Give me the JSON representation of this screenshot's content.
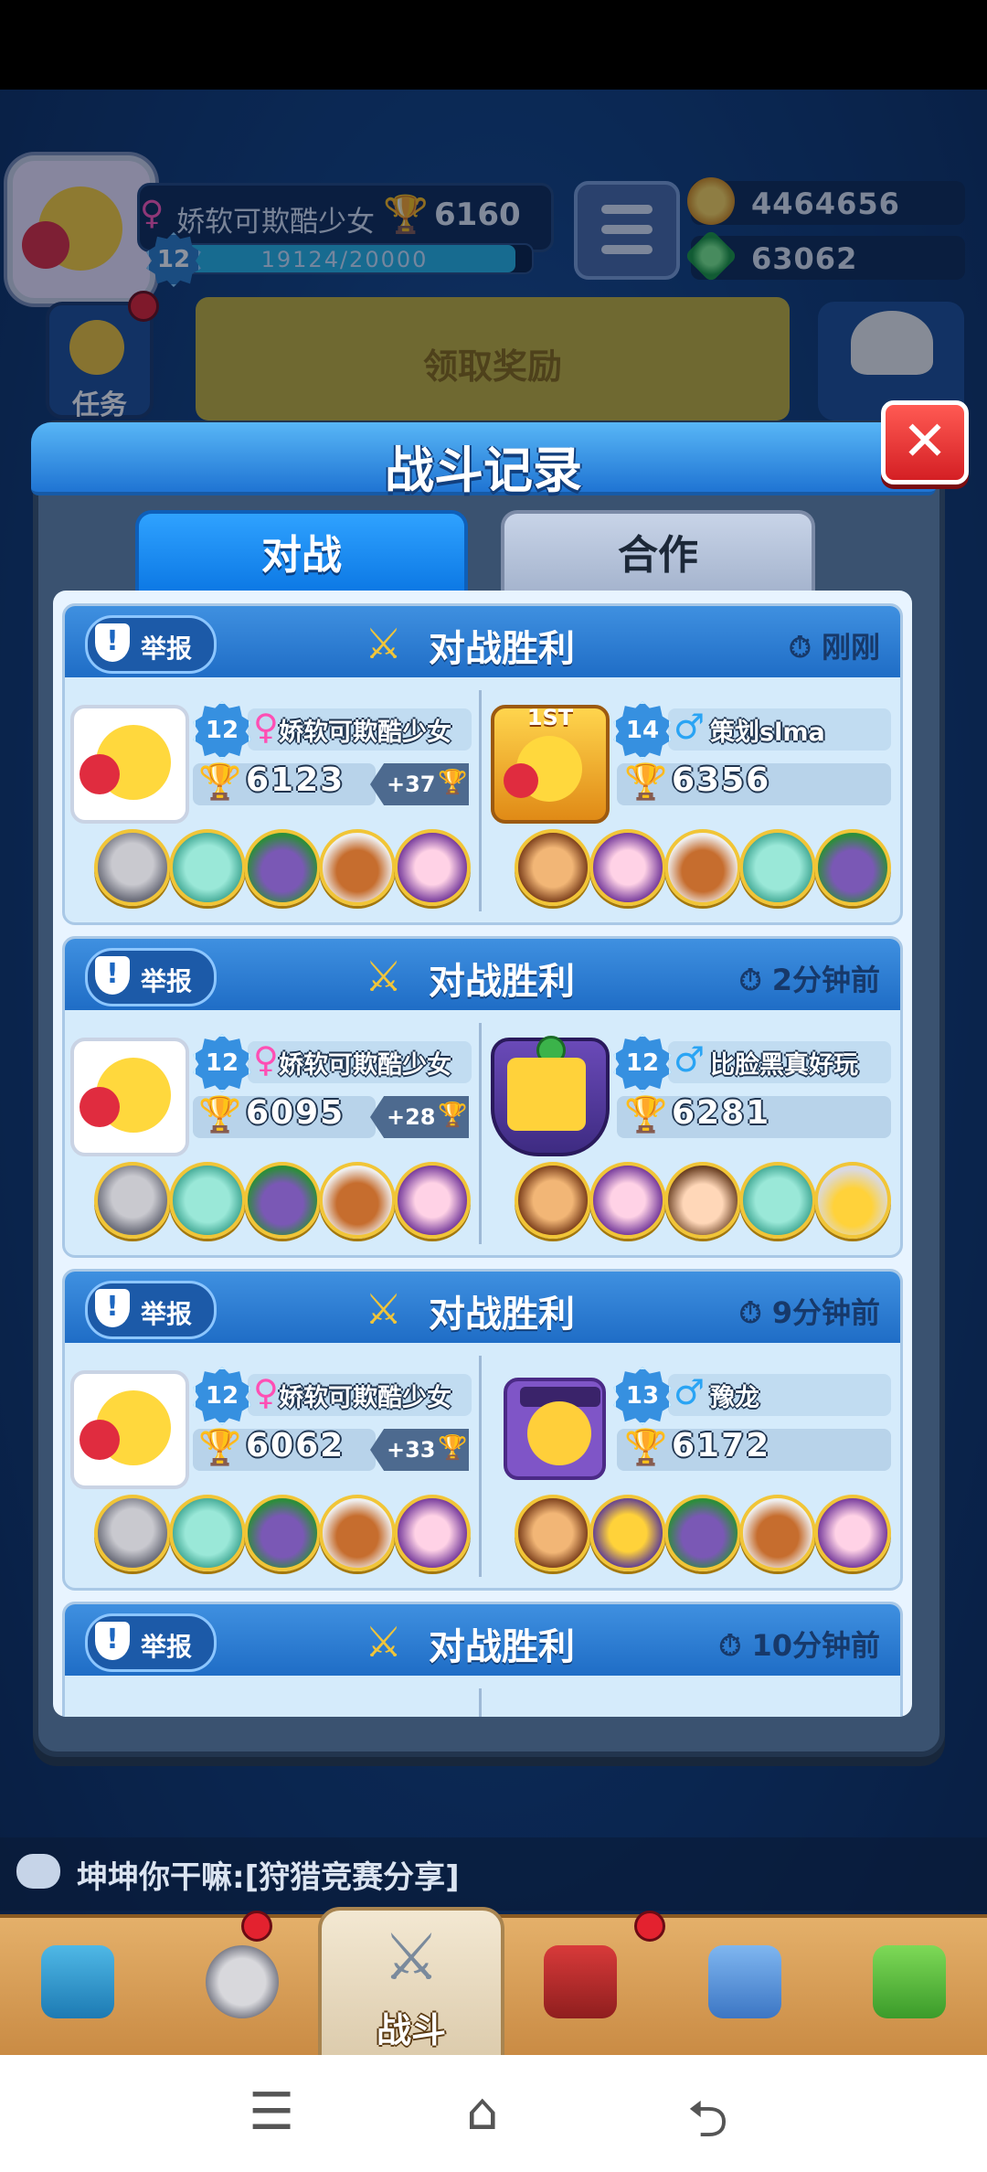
{
  "hud": {
    "player_name": "娇软可欺酷少女",
    "trophies": "6160",
    "level": "12",
    "xp_text": "19124/20000",
    "xp_fraction": 0.956,
    "coins": "4464656",
    "gems": "63062",
    "task_label": "任务",
    "reward_label": "领取奖励"
  },
  "dialog": {
    "title": "战斗记录",
    "close_label": "✕",
    "tabs": [
      {
        "label": "对战",
        "active": true
      },
      {
        "label": "合作",
        "active": false
      }
    ],
    "report_label": "举报",
    "records": [
      {
        "result": "对战胜利",
        "time": "刚刚",
        "left": {
          "level": "12",
          "gender": "♀",
          "name": "娇软可欺酷少女",
          "trophies": "6123",
          "delta": "+37",
          "heroes": [
            "knight",
            "cat",
            "green",
            "dwarf",
            "purple"
          ]
        },
        "right": {
          "level": "14",
          "gender": "♂",
          "name": "策划slma",
          "trophies": "6356",
          "badge": "1ST",
          "heroes": [
            "monkey",
            "purple",
            "dwarf",
            "cat",
            "green"
          ]
        }
      },
      {
        "result": "对战胜利",
        "time": "2分钟前",
        "left": {
          "level": "12",
          "gender": "♀",
          "name": "娇软可欺酷少女",
          "trophies": "6095",
          "delta": "+28",
          "heroes": [
            "knight",
            "cat",
            "green",
            "dwarf",
            "purple"
          ]
        },
        "right": {
          "level": "12",
          "gender": "♂",
          "name": "比脸黑真好玩",
          "trophies": "6281",
          "heroes": [
            "monkey",
            "purple",
            "girl",
            "cat",
            "ghost"
          ]
        }
      },
      {
        "result": "对战胜利",
        "time": "9分钟前",
        "left": {
          "level": "12",
          "gender": "♀",
          "name": "娇软可欺酷少女",
          "trophies": "6062",
          "delta": "+33",
          "heroes": [
            "knight",
            "cat",
            "green",
            "dwarf",
            "purple"
          ]
        },
        "right": {
          "level": "13",
          "gender": "♂",
          "name": "豫龙",
          "trophies": "6172",
          "heroes": [
            "monkey",
            "frog",
            "green",
            "dwarf",
            "purple"
          ]
        }
      },
      {
        "result": "对战胜利",
        "time": "10分钟前"
      }
    ]
  },
  "chat": {
    "message": "坤坤你干嘛:[狩猎竞赛分享]"
  },
  "bottom_nav": {
    "battle_label": "战斗",
    "items": [
      "treasure-chest",
      "helmet",
      "battle",
      "crown-shield",
      "team",
      "garden"
    ]
  },
  "colors": {
    "accent_blue": "#1f74d3",
    "close_red": "#d41f24",
    "female_pink": "#ff4fb4",
    "male_blue": "#2aa4f4",
    "trophy_gold": "#f1a91a"
  }
}
